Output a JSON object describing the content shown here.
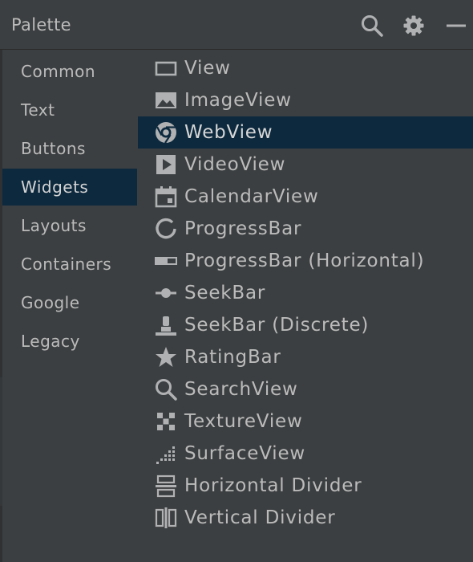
{
  "header": {
    "title": "Palette"
  },
  "colors": {
    "panel": "#3c3f41",
    "selection": "#0d293e",
    "text": "#bbbbbb",
    "icon": "#afb1b3"
  },
  "categories": [
    {
      "label": "Common"
    },
    {
      "label": "Text"
    },
    {
      "label": "Buttons"
    },
    {
      "label": "Widgets",
      "selected": true
    },
    {
      "label": "Layouts"
    },
    {
      "label": "Containers"
    },
    {
      "label": "Google"
    },
    {
      "label": "Legacy"
    }
  ],
  "widgets": [
    {
      "label": "View",
      "icon": "view-icon"
    },
    {
      "label": "ImageView",
      "icon": "image-icon"
    },
    {
      "label": "WebView",
      "icon": "globe-icon",
      "selected": true
    },
    {
      "label": "VideoView",
      "icon": "play-icon"
    },
    {
      "label": "CalendarView",
      "icon": "calendar-icon"
    },
    {
      "label": "ProgressBar",
      "icon": "progress-circle-icon"
    },
    {
      "label": "ProgressBar (Horizontal)",
      "icon": "progress-horizontal-icon"
    },
    {
      "label": "SeekBar",
      "icon": "seekbar-icon"
    },
    {
      "label": "SeekBar (Discrete)",
      "icon": "seekbar-discrete-icon"
    },
    {
      "label": "RatingBar",
      "icon": "star-icon"
    },
    {
      "label": "SearchView",
      "icon": "search-icon"
    },
    {
      "label": "TextureView",
      "icon": "texture-icon"
    },
    {
      "label": "SurfaceView",
      "icon": "surface-icon"
    },
    {
      "label": "Horizontal Divider",
      "icon": "horizontal-divider-icon"
    },
    {
      "label": "Vertical Divider",
      "icon": "vertical-divider-icon"
    }
  ]
}
